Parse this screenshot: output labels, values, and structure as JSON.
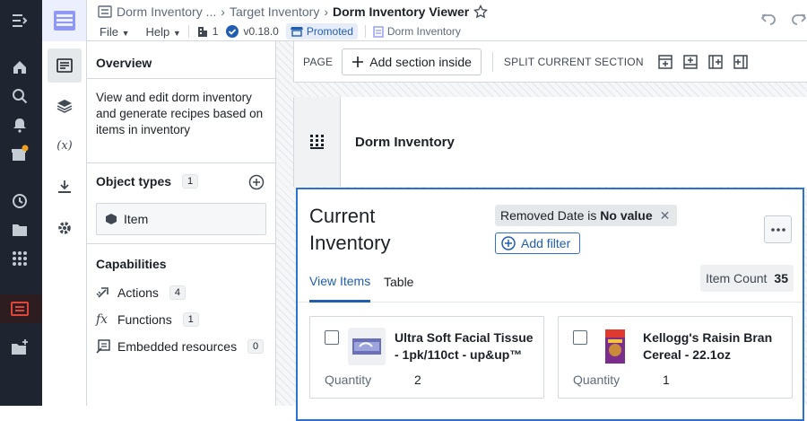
{
  "breadcrumb": {
    "parent1": "Dorm Inventory ...",
    "parent2": "Target Inventory",
    "current": "Dorm Inventory Viewer"
  },
  "menu": {
    "file": "File",
    "help": "Help",
    "user_count": "1",
    "version": "v0.18.0",
    "status": "Promoted",
    "app_ref": "Dorm Inventory"
  },
  "panel": {
    "overview_title": "Overview",
    "description": "View and edit dorm inventory and generate recipes based on items in inventory",
    "object_types_title": "Object types",
    "object_types_count": "1",
    "object_types": [
      "Item"
    ],
    "capabilities_title": "Capabilities",
    "capabilities": [
      {
        "label": "Actions",
        "count": "4",
        "icon": "actions-icon"
      },
      {
        "label": "Functions",
        "count": "1",
        "icon": "functions-icon"
      },
      {
        "label": "Embedded resources",
        "count": "0",
        "icon": "embedded-resources-icon"
      }
    ]
  },
  "toolbar": {
    "page_label": "PAGE",
    "add_section": "Add section inside",
    "split_label": "SPLIT CURRENT SECTION"
  },
  "section": {
    "title": "Dorm Inventory"
  },
  "widget": {
    "title": "Current Inventory",
    "filter_field": "Removed Date",
    "filter_op": "is",
    "filter_value": "No value",
    "add_filter": "Add filter",
    "tabs": [
      "View Items",
      "Table"
    ],
    "item_count_label": "Item Count",
    "item_count": "35",
    "items": [
      {
        "name": "Ultra Soft Facial Tissue - 1pk/110ct - up&up™",
        "quantity_label": "Quantity",
        "quantity": "2"
      },
      {
        "name": "Kellogg's Raisin Bran Cereal - 22.1oz",
        "quantity_label": "Quantity",
        "quantity": "1"
      }
    ]
  },
  "colors": {
    "accent": "#2d72d2",
    "rail": "#1f2530",
    "notification": "#f0a020"
  }
}
